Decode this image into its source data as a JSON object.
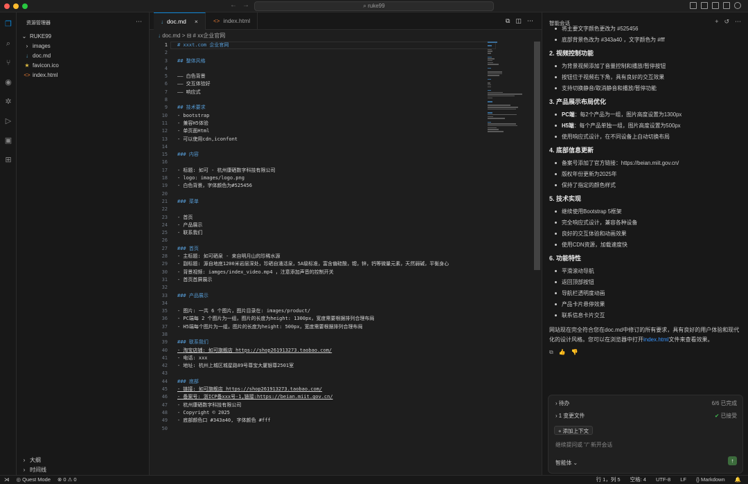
{
  "window": {
    "search_text": "ruke99"
  },
  "sidebar": {
    "title": "资源管理器",
    "root": "RUKE99",
    "items": [
      {
        "label": "images",
        "icon": "chevron-right-icon"
      },
      {
        "label": "doc.md",
        "icon": "markdown-file-icon"
      },
      {
        "label": "favicon.ico",
        "icon": "image-file-icon"
      },
      {
        "label": "index.html",
        "icon": "html-file-icon"
      }
    ],
    "outline": "大纲",
    "timeline": "时间线"
  },
  "tabs": [
    {
      "label": "doc.md",
      "active": true
    },
    {
      "label": "index.html",
      "active": false
    }
  ],
  "breadcrumb": {
    "file": "doc.md",
    "sep": ">",
    "section": "# xx企业官网"
  },
  "code_lines": [
    {
      "n": "1",
      "text": "# xxxt.com 企业官网",
      "kind": "h"
    },
    {
      "n": "2",
      "text": "",
      "kind": "t"
    },
    {
      "n": "3",
      "text": "## 整体风格",
      "kind": "h"
    },
    {
      "n": "4",
      "text": "",
      "kind": "t"
    },
    {
      "n": "5",
      "text": "—— 白色背景",
      "kind": "t"
    },
    {
      "n": "6",
      "text": "—— 交互体验好",
      "kind": "t"
    },
    {
      "n": "7",
      "text": "—— 响应式",
      "kind": "t"
    },
    {
      "n": "8",
      "text": "",
      "kind": "t"
    },
    {
      "n": "9",
      "text": "## 技术要求",
      "kind": "h"
    },
    {
      "n": "10",
      "text": "- bootstrap",
      "kind": "t"
    },
    {
      "n": "11",
      "text": "- 兼容H5体验",
      "kind": "t"
    },
    {
      "n": "12",
      "text": "- 单页面Html",
      "kind": "t"
    },
    {
      "n": "13",
      "text": "- 可以使用cdn,iconfont",
      "kind": "t"
    },
    {
      "n": "14",
      "text": "",
      "kind": "t"
    },
    {
      "n": "15",
      "text": "### 内容",
      "kind": "h"
    },
    {
      "n": "16",
      "text": "",
      "kind": "t"
    },
    {
      "n": "17",
      "text": "- 标题: 如可 - 杭州康硒数字科技有限公司",
      "kind": "t"
    },
    {
      "n": "18",
      "text": "- logo: images/logo.png",
      "kind": "t"
    },
    {
      "n": "19",
      "text": "- 白色背景，字体颜色为#525456",
      "kind": "t"
    },
    {
      "n": "20",
      "text": "",
      "kind": "t"
    },
    {
      "n": "21",
      "text": "### 菜单",
      "kind": "h"
    },
    {
      "n": "22",
      "text": "",
      "kind": "t"
    },
    {
      "n": "23",
      "text": "- 首页",
      "kind": "t"
    },
    {
      "n": "24",
      "text": "- 产品展示",
      "kind": "t"
    },
    {
      "n": "25",
      "text": "- 联系我们",
      "kind": "t"
    },
    {
      "n": "26",
      "text": "",
      "kind": "t"
    },
    {
      "n": "27",
      "text": "### 首页",
      "kind": "h"
    },
    {
      "n": "28",
      "text": "- 主标题: 如可硒泉 - 来自明月山的珍稀水源",
      "kind": "t"
    },
    {
      "n": "29",
      "text": "- 副标题: 源自地底1200米岩层深处，珍硒自涌活泉，5A级标准，富含偏硅酸，锶，锌，钙等微量元素，天然弱碱，平衡身心",
      "kind": "t"
    },
    {
      "n": "30",
      "text": "- 背景视频: iamges/index_video.mp4 ，注意添加声音的控制开关",
      "kind": "t"
    },
    {
      "n": "31",
      "text": "- 首页首屏展示",
      "kind": "t"
    },
    {
      "n": "32",
      "text": "",
      "kind": "t"
    },
    {
      "n": "33",
      "text": "### 产品展示",
      "kind": "h"
    },
    {
      "n": "34",
      "text": "",
      "kind": "t"
    },
    {
      "n": "35",
      "text": "- 图片: 一共 6 个图片，图片目录在: images/product/",
      "kind": "t"
    },
    {
      "n": "36",
      "text": "- PC端每 2 个图片为一组，图片的长度为height: 1300px，宽度需要根据排列合理布局",
      "kind": "t"
    },
    {
      "n": "37",
      "text": "- H5端每个图片为一组，图片的长度为height: 500px，宽度需要根据排列合理布局",
      "kind": "t"
    },
    {
      "n": "38",
      "text": "",
      "kind": "t"
    },
    {
      "n": "39",
      "text": "### 联系我们",
      "kind": "h"
    },
    {
      "n": "40",
      "text": "- 淘宝店铺: 如可旗舰店 https://shop261913273.taobao.com/",
      "kind": "l"
    },
    {
      "n": "41",
      "text": "- 电话: xxx",
      "kind": "t"
    },
    {
      "n": "42",
      "text": "- 地址: 杭州上城区城星路89号尊宝大厦银尊2501室",
      "kind": "t"
    },
    {
      "n": "43",
      "text": "",
      "kind": "t"
    },
    {
      "n": "44",
      "text": "### 底部",
      "kind": "h"
    },
    {
      "n": "45",
      "text": "- 链接: 如可旗舰店 https://shop261913273.taobao.com/",
      "kind": "l"
    },
    {
      "n": "46",
      "text": "- 备案号: 浙ICP备xxx号-1,链接:https://beian.miit.gov.cn/",
      "kind": "l"
    },
    {
      "n": "47",
      "text": "- 杭州康硒数字科技有限公司",
      "kind": "t"
    },
    {
      "n": "48",
      "text": "- Copyright © 2025",
      "kind": "t"
    },
    {
      "n": "49",
      "text": "- 底部颜色口 #343a40, 字体颜色 #fff",
      "kind": "t"
    },
    {
      "n": "50",
      "text": "",
      "kind": "t"
    }
  ],
  "chat": {
    "title": "智能会话",
    "top_bullets": [
      "将主要文字颜色更改为 #525456",
      "底部背景色改为 #343a40 ，文字颜色为 #fff"
    ],
    "sections": [
      {
        "title": "2. 视频控制功能",
        "bullets": [
          {
            "b": "",
            "t": "为背景视频添加了音量控制和播放/暂停按钮"
          },
          {
            "b": "",
            "t": "按钮位于视频右下角，具有良好的交互效果"
          },
          {
            "b": "",
            "t": "支持切换静音/取消静音和播放/暂停功能"
          }
        ]
      },
      {
        "title": "3. 产品展示布局优化",
        "bullets": [
          {
            "b": "PC端",
            "t": "：每2个产品为一组，图片高度设置为1300px"
          },
          {
            "b": "H5端",
            "t": "：每个产品单独一组，图片高度设置为500px"
          },
          {
            "b": "",
            "t": "使用响应式设计，在不同设备上自动切换布局"
          }
        ]
      },
      {
        "title": "4. 底部信息更新",
        "bullets": [
          {
            "b": "",
            "t": "备案号添加了官方链接：https://beian.miit.gov.cn/"
          },
          {
            "b": "",
            "t": "版权年份更新为2025年"
          },
          {
            "b": "",
            "t": "保持了指定的颜色样式"
          }
        ]
      },
      {
        "title": "5. 技术实现",
        "bullets": [
          {
            "b": "",
            "t": "继续使用Bootstrap 5框架"
          },
          {
            "b": "",
            "t": "完全响应式设计，兼容各种设备"
          },
          {
            "b": "",
            "t": "良好的交互体验和动画效果"
          },
          {
            "b": "",
            "t": "使用CDN资源，加载速度快"
          }
        ]
      },
      {
        "title": "6. 功能特性",
        "bullets": [
          {
            "b": "",
            "t": "平滑滚动导航"
          },
          {
            "b": "",
            "t": "返回顶部按钮"
          },
          {
            "b": "",
            "t": "导航栏透明度动画"
          },
          {
            "b": "",
            "t": "产品卡片悬停效果"
          },
          {
            "b": "",
            "t": "联系信息卡片交互"
          }
        ]
      }
    ],
    "summary_1": "网站现在完全符合您在doc.md中修订的所有要求，具有良好的用户体验和现代化的设计风格。您可以在浏览器中打开",
    "summary_link": "index.html",
    "summary_2": "文件来查看效果。",
    "todo_label": "待办",
    "todo_status": "6/6 已完成",
    "changes_label": "1 变更文件",
    "changes_status": "已接受",
    "add_context": "+ 添加上下文",
    "input_placeholder": "继续提问或 \"/\" 新开会话",
    "mode": "智能体 ⌄"
  },
  "status": {
    "mode": "Quest Mode",
    "problems": "⊗ 0 ⚠ 0",
    "position": "行 1，列 5",
    "spaces": "空格: 4",
    "encoding": "UTF-8",
    "eol": "LF",
    "language": "{} Markdown"
  },
  "colors": {
    "accent": "#0a84d6",
    "heading": "#569cd6"
  }
}
